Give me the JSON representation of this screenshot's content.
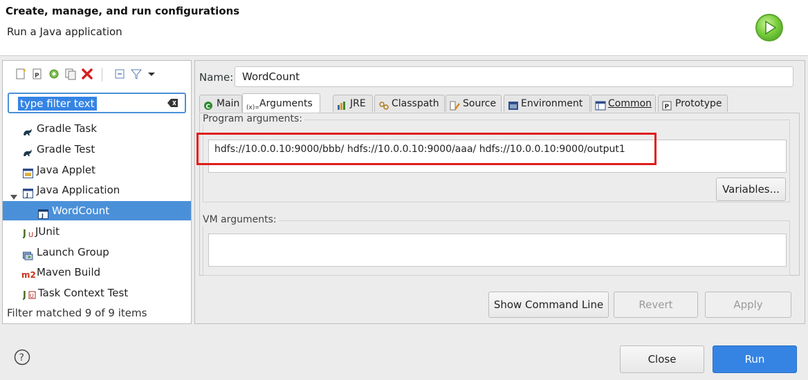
{
  "header": {
    "title": "Create, manage, and run configurations",
    "subtitle": "Run a Java application",
    "logo_icon": "run-icon"
  },
  "toolbar": {
    "icons": [
      "new-config-icon",
      "new-prototype-icon",
      "export-icon",
      "duplicate-icon",
      "delete-icon",
      "collapse-all-icon",
      "filter-icon",
      "view-menu-icon"
    ]
  },
  "filter": {
    "value": "type filter text"
  },
  "tree": {
    "items": [
      {
        "label": "Gradle Task",
        "icon": "gradle-icon"
      },
      {
        "label": "Gradle Test",
        "icon": "gradle-icon"
      },
      {
        "label": "Java Applet",
        "icon": "applet-icon"
      },
      {
        "label": "Java Application",
        "icon": "java-app-icon",
        "expanded": true
      },
      {
        "label": "WordCount",
        "icon": "java-app-icon",
        "selected": true
      },
      {
        "label": "JUnit",
        "icon": "junit-icon"
      },
      {
        "label": "Launch Group",
        "icon": "launch-group-icon"
      },
      {
        "label": "Maven Build",
        "icon": "maven-icon"
      },
      {
        "label": "Task Context Test",
        "icon": "task-context-icon"
      }
    ]
  },
  "status": "Filter matched 9 of 9 items",
  "name_label": "Name:",
  "name_value": "WordCount",
  "tabs": [
    {
      "label": "Main",
      "icon": "main-icon"
    },
    {
      "label": "Arguments",
      "icon": "arguments-icon",
      "active": true
    },
    {
      "label": "JRE",
      "icon": "jre-icon"
    },
    {
      "label": "Classpath",
      "icon": "classpath-icon"
    },
    {
      "label": "Source",
      "icon": "source-icon"
    },
    {
      "label": "Environment",
      "icon": "environment-icon"
    },
    {
      "label": "Common",
      "icon": "common-icon"
    },
    {
      "label": "Prototype",
      "icon": "prototype-icon"
    }
  ],
  "program_args": {
    "label": "Program arguments:",
    "value": "hdfs://10.0.0.10:9000/bbb/  hdfs://10.0.0.10:9000/aaa/  hdfs://10.0.0.10:9000/output1",
    "variables_button": "Variables..."
  },
  "vm_args": {
    "label": "VM arguments:",
    "value": ""
  },
  "actions": {
    "show_command_line": "Show Command Line",
    "revert": "Revert",
    "apply": "Apply"
  },
  "footer": {
    "close": "Close",
    "run": "Run"
  },
  "colors": {
    "accent": "#3584e4",
    "highlight": "#e01b1b"
  }
}
